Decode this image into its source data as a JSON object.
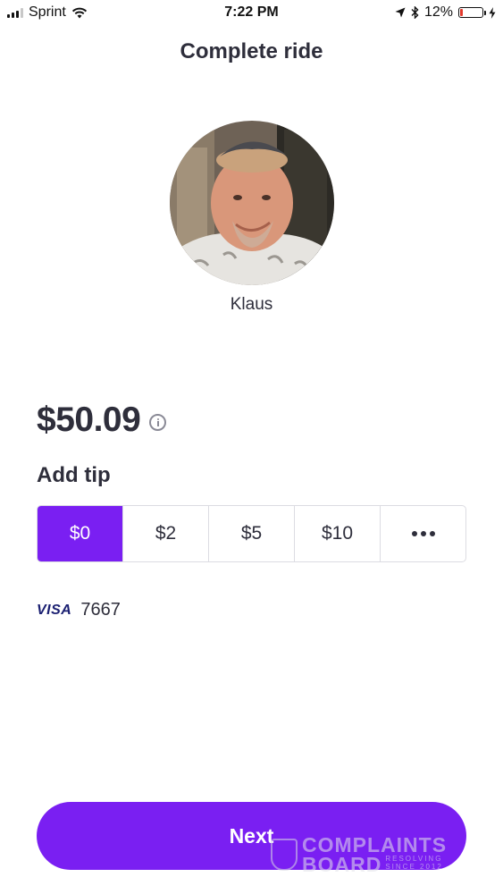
{
  "status_bar": {
    "carrier": "Sprint",
    "time": "7:22 PM",
    "battery": "12%",
    "battery_level": 0.12,
    "icons": [
      "signal-icon",
      "wifi-icon",
      "location-arrow-icon",
      "bluetooth-icon",
      "battery-icon",
      "charging-bolt-icon"
    ]
  },
  "header": {
    "title": "Complete ride"
  },
  "driver": {
    "name": "Klaus",
    "avatar_icon": "driver-avatar-photo"
  },
  "fare": {
    "amount": "$50.09",
    "info_icon": "info-icon"
  },
  "tip": {
    "heading": "Add tip",
    "options": [
      "$0",
      "$2",
      "$5",
      "$10"
    ],
    "more_icon": "more-options-icon",
    "selected": "$0"
  },
  "payment": {
    "brand": "VISA",
    "last4": "7667"
  },
  "actions": {
    "next_label": "Next"
  },
  "watermark": {
    "line1": "COMPLAINTS",
    "line2": "BOARD",
    "tag1": "RESOLVING",
    "tag2": "SINCE 2012"
  },
  "colors": {
    "accent": "#7a1ff2",
    "text": "#2e2e3b",
    "visa": "#1a1f71",
    "battery_low": "#e2392c"
  }
}
